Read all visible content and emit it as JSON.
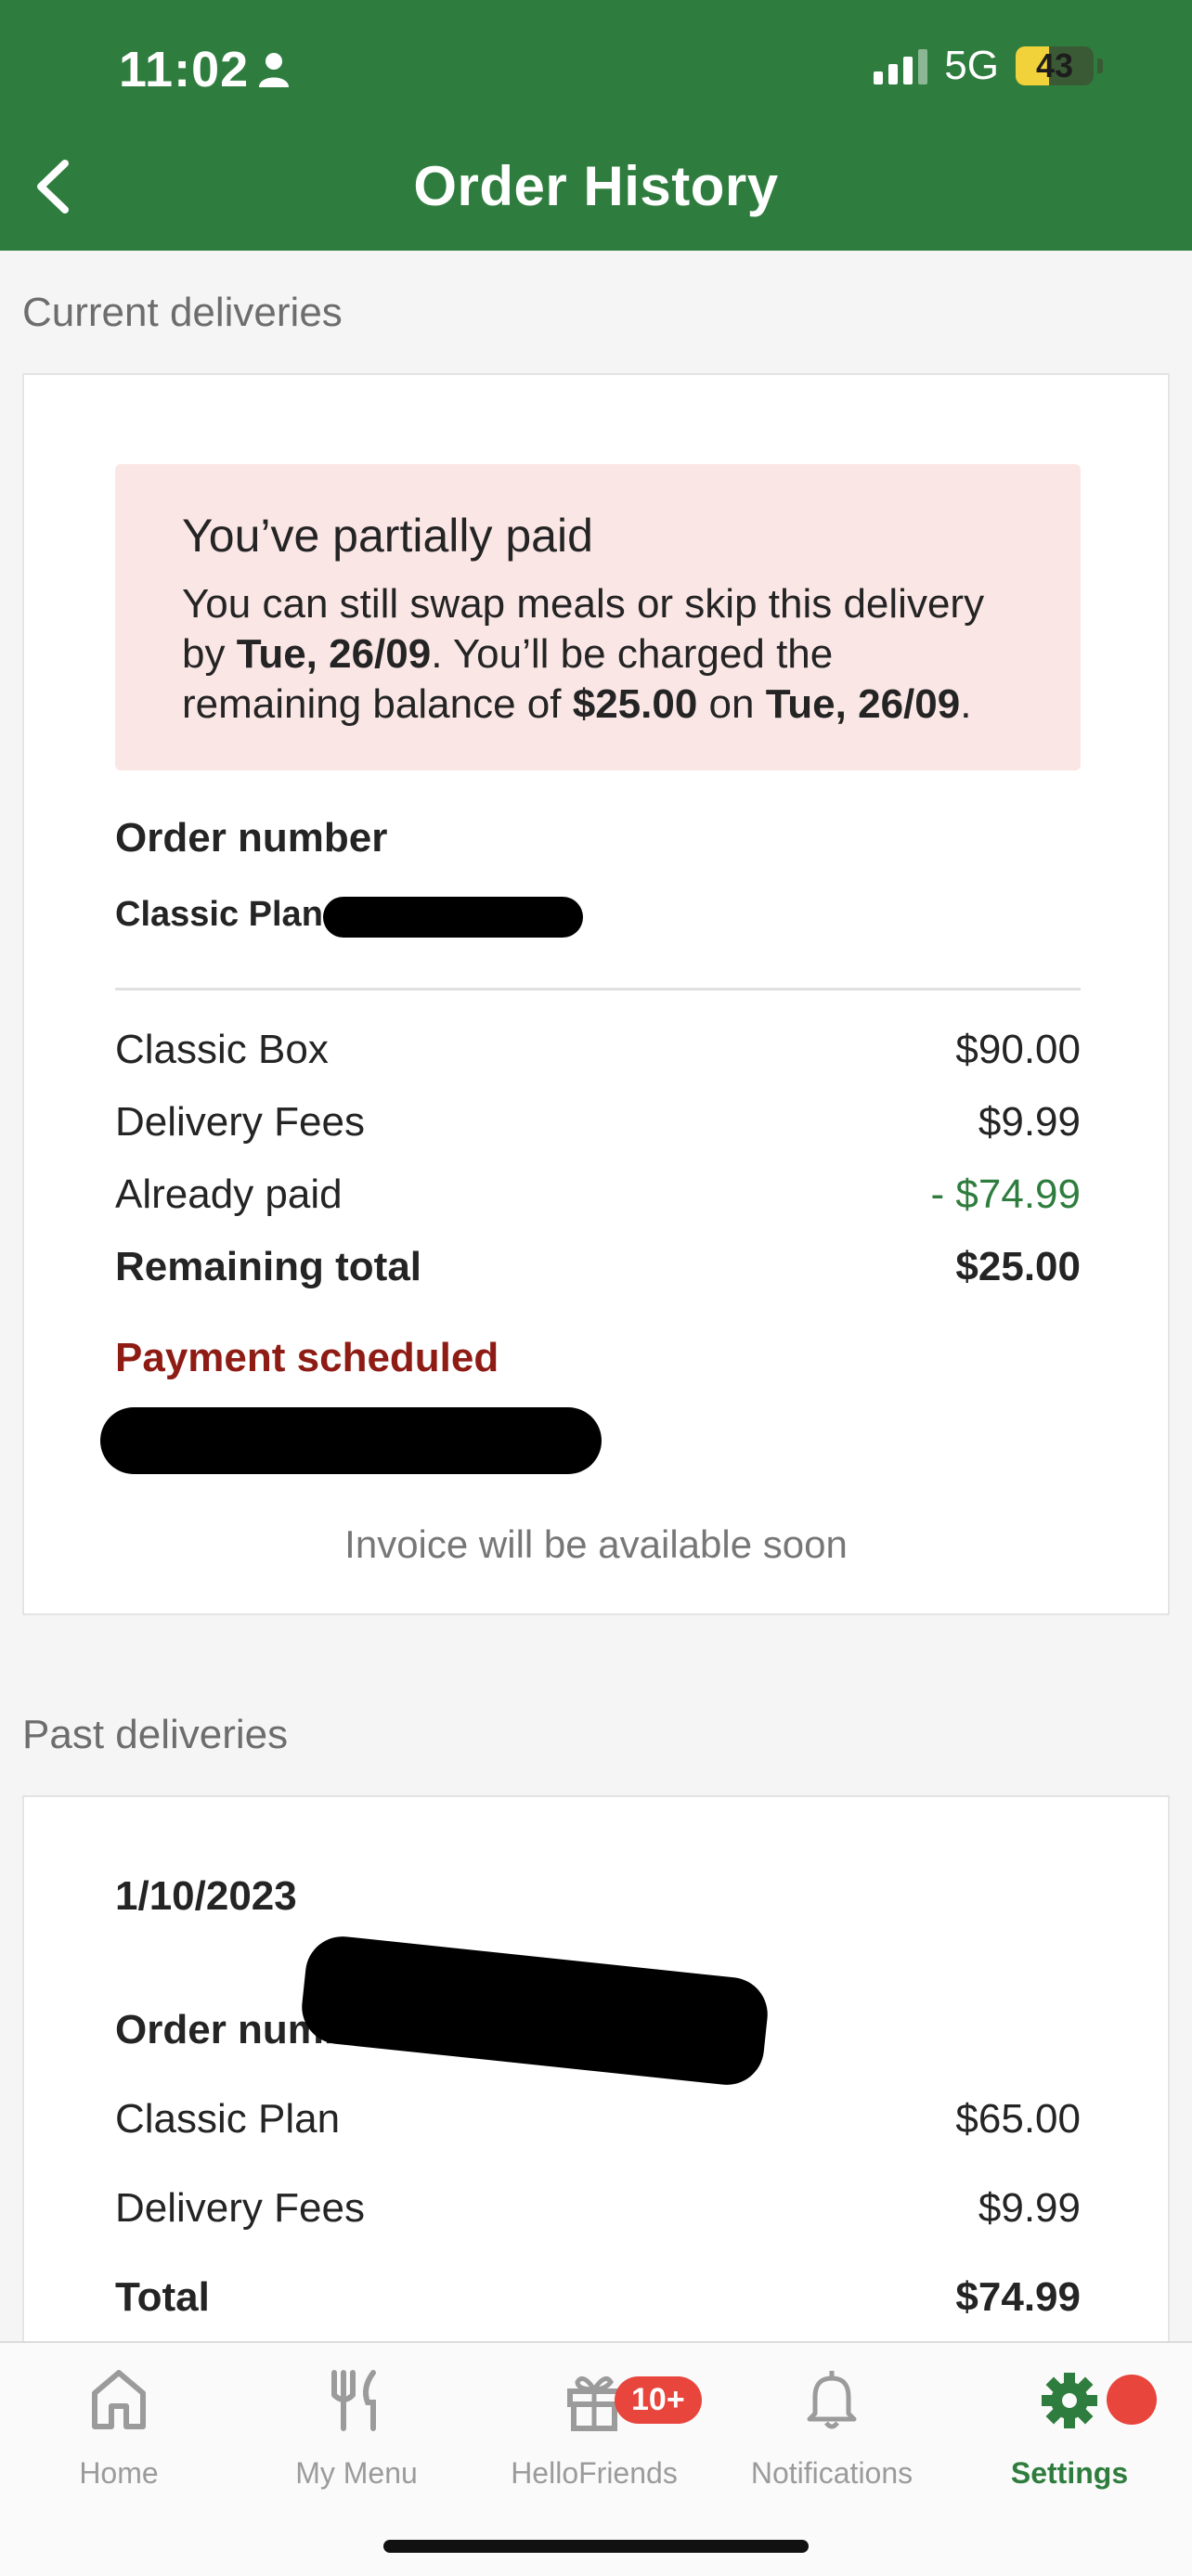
{
  "status_bar": {
    "time": "11:02",
    "network": "5G",
    "battery": "43",
    "battery_level": 0.43
  },
  "header": {
    "title": "Order History"
  },
  "current": {
    "section_label": "Current deliveries",
    "alert": {
      "title": "You’ve partially paid",
      "line1": "You can still swap meals or skip this delivery",
      "by": "by ",
      "date1": "Tue, 26/09",
      "line2_rest": ". You’ll be charged the",
      "line3_start": "remaining balance of ",
      "amount": "$25.00",
      "on": " on ",
      "date2": "Tue, 26/09",
      "period": "."
    },
    "order_number_label": "Order number",
    "plan_label": "Classic Plan",
    "rows": [
      {
        "label": "Classic Box",
        "value": "$90.00"
      },
      {
        "label": "Delivery Fees",
        "value": "$9.99"
      },
      {
        "label": "Already paid",
        "value": "- $74.99"
      },
      {
        "label": "Remaining total",
        "value": "$25.00"
      }
    ],
    "payment_status": "Payment scheduled",
    "invoice_note": "Invoice will be available soon"
  },
  "past": {
    "section_label": "Past deliveries",
    "date": "1/10/2023",
    "order_number_label": "Order numbe",
    "rows": [
      {
        "label": "Classic Plan",
        "value": "$65.00"
      },
      {
        "label": "Delivery Fees",
        "value": "$9.99"
      },
      {
        "label": "Total",
        "value": "$74.99"
      }
    ]
  },
  "tabbar": {
    "tabs": [
      {
        "label": "Home",
        "icon": "home-icon"
      },
      {
        "label": "My Menu",
        "icon": "fork-knife-icon"
      },
      {
        "label": "HelloFriends",
        "icon": "gift-icon",
        "badge": "10+"
      },
      {
        "label": "Notifications",
        "icon": "bell-icon"
      },
      {
        "label": "Settings",
        "icon": "gear-icon",
        "active": true
      }
    ]
  },
  "colors": {
    "brand_green": "#2f7d3e",
    "alert_bg": "#fbe6e6",
    "payment_red": "#8e1b14",
    "badge_red": "#e8453c"
  }
}
